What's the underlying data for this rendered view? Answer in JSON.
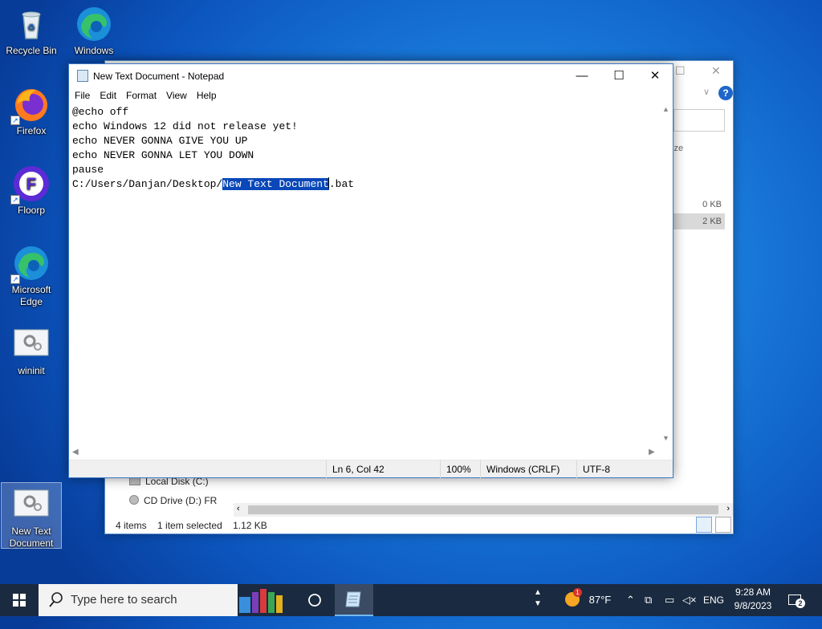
{
  "desktop": {
    "icons": [
      {
        "label": "Recycle Bin",
        "icon": "recycle-bin-icon"
      },
      {
        "label": "Windows",
        "icon": "edge-icon"
      },
      {
        "label": "Firefox",
        "icon": "firefox-icon"
      },
      {
        "label": "Floorp",
        "icon": "floorp-icon"
      },
      {
        "label": "Microsoft Edge",
        "icon": "edge-icon"
      },
      {
        "label": "wininit",
        "icon": "gear-file-icon"
      },
      {
        "label": "New Text Document",
        "icon": "gear-file-icon"
      }
    ]
  },
  "explorer": {
    "column_header": "ize",
    "sizes": [
      "0 KB",
      "2 KB"
    ],
    "nav": [
      {
        "label": "Local Disk (C:)",
        "icon": "drive-icon"
      },
      {
        "label": "CD Drive (D:) FR",
        "icon": "cd-drive-icon"
      }
    ],
    "status": {
      "items": "4 items",
      "selected": "1 item selected",
      "size": "1.12 KB"
    }
  },
  "notepad": {
    "title": "New Text Document - Notepad",
    "menu": [
      "File",
      "Edit",
      "Format",
      "View",
      "Help"
    ],
    "lines": [
      "@echo off",
      "echo Windows 12 did not release yet!",
      "echo NEVER GONNA GIVE YOU UP",
      "echo NEVER GONNA LET YOU DOWN",
      "pause"
    ],
    "last_line": {
      "before": "C:/Users/Danjan/Desktop/",
      "selected": "New Text Document",
      "after": ".bat"
    },
    "status": {
      "position": "Ln 6, Col 42",
      "zoom": "100%",
      "line_ending": "Windows (CRLF)",
      "encoding": "UTF-8"
    }
  },
  "taskbar": {
    "search_placeholder": "Type here to search",
    "weather": "87°F",
    "weather_badge": "1",
    "language": "ENG",
    "time": "9:28 AM",
    "date": "9/8/2023",
    "notification_count": "2"
  }
}
